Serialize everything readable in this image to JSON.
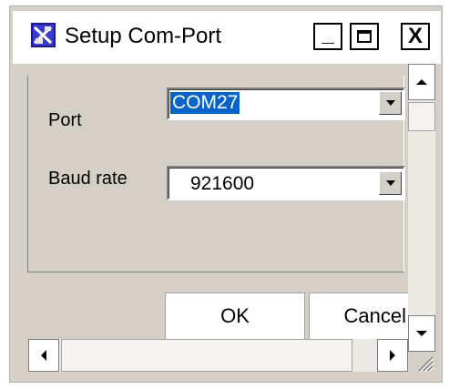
{
  "window": {
    "title": "Setup Com-Port"
  },
  "icons": {
    "app": "app-icon",
    "minimize": "minimize-icon",
    "maximize": "maximize-icon",
    "close": "close-icon",
    "dropdown": "chevron-down-icon"
  },
  "title_buttons": {
    "minimize": "_",
    "close": "X"
  },
  "form": {
    "port": {
      "label": "Port",
      "value": "COM27",
      "selected": true
    },
    "baud": {
      "label": "Baud rate",
      "value": "921600"
    }
  },
  "buttons": {
    "ok": "OK",
    "cancel": "Cancel"
  },
  "colors": {
    "selection": "#0a64c8",
    "face": "#d4d0c8",
    "titlebar": "#ffffff"
  }
}
